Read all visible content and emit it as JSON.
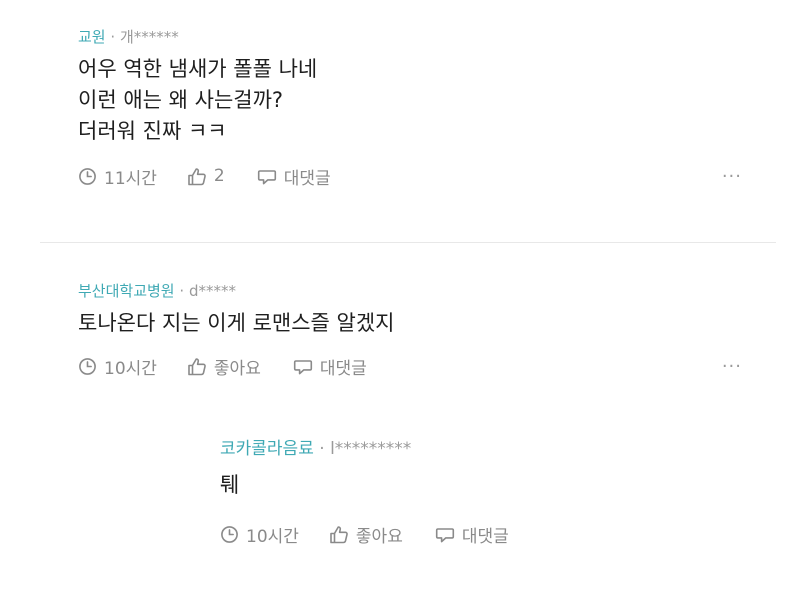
{
  "comments": [
    {
      "author": "교원",
      "separator": "·",
      "handle": "개******",
      "lines": [
        "어우 역한 냄새가 폴폴 나네",
        "이런 애는 왜 사는걸까?",
        "더러워 진짜 ㅋㅋ"
      ],
      "time": "11시간",
      "likes": "2",
      "reply": "대댓글",
      "more": "···"
    },
    {
      "author": "부산대학교병원",
      "separator": "·",
      "handle": "d*****",
      "lines": [
        "토나온다 지는 이게 로맨스즐 알겠지"
      ],
      "time": "10시간",
      "likes": "좋아요",
      "reply": "대댓글",
      "more": "···"
    },
    {
      "author": "코카콜라음료",
      "separator": "·",
      "handle": "l*********",
      "lines": [
        "퉤"
      ],
      "time": "10시간",
      "likes": "좋아요",
      "reply": "대댓글"
    }
  ],
  "icons": {
    "time": "clock-icon",
    "like": "thumbs-up-icon",
    "reply": "speech-bubble-icon"
  },
  "colors": {
    "author": "#3fa9b4",
    "meta": "#9a9a9a",
    "text": "#1f1f1f",
    "action": "#8a8a8a",
    "divider": "#e8e8e8"
  }
}
